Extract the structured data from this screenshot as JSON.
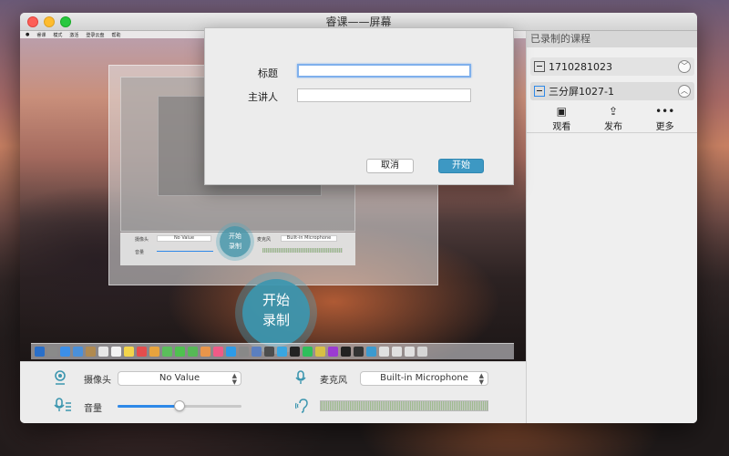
{
  "window": {
    "title": "睿课——屏幕"
  },
  "preview": {
    "menubar": [
      "睿课",
      "模式",
      "激活",
      "登录云盘",
      "帮助"
    ],
    "nested_camera_label": "摄像头",
    "nested_camera_value": "No Value",
    "nested_mic_label": "麦克风",
    "nested_mic_value": "Built-in Microphone",
    "nested_volume_label": "音量",
    "mini_record_line1": "开始",
    "mini_record_line2": "录制",
    "record_line1": "开始",
    "record_line2": "录制"
  },
  "controls": {
    "camera_label": "摄像头",
    "camera_value": "No Value",
    "mic_label": "麦克风",
    "mic_value": "Built-in Microphone",
    "volume_label": "音量",
    "volume_level": 0.5
  },
  "sidebar": {
    "header": "已录制的课程",
    "courses": [
      {
        "name": "1710281023",
        "expanded": false
      },
      {
        "name": "三分屏1027-1",
        "expanded": true
      }
    ],
    "actions": [
      {
        "label": "观看",
        "icon": "play-screen-icon"
      },
      {
        "label": "发布",
        "icon": "upload-icon"
      },
      {
        "label": "更多",
        "icon": "more-icon"
      }
    ]
  },
  "dialog": {
    "title_label": "标题",
    "title_value": "",
    "speaker_label": "主讲人",
    "speaker_value": "",
    "cancel_label": "取消",
    "start_label": "开始"
  },
  "colors": {
    "accent": "#2f89e8",
    "record": "#3c96af",
    "start_button": "#3d98c3"
  }
}
